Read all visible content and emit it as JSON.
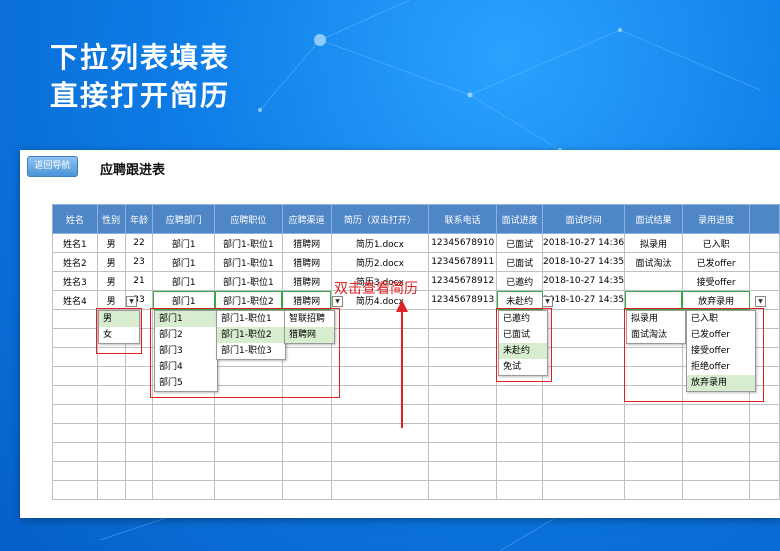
{
  "hero": {
    "line1": "下拉列表填表",
    "line2": "直接打开简历"
  },
  "sheet": {
    "nav_button": "返回导航",
    "title": "应聘跟进表"
  },
  "table": {
    "headers": [
      "姓名",
      "性别",
      "年龄",
      "应聘部门",
      "应聘职位",
      "应聘渠道",
      "简历（双击打开）",
      "联系电话",
      "面试进度",
      "面试时间",
      "面试结果",
      "录用进度"
    ],
    "rows": [
      [
        "姓名1",
        "男",
        "22",
        "部门1",
        "部门1-职位1",
        "猎聘网",
        "简历1.docx",
        "12345678910",
        "已面试",
        "2018-10-27 14:36",
        "拟录用",
        "已入职"
      ],
      [
        "姓名2",
        "男",
        "23",
        "部门1",
        "部门1-职位1",
        "猎聘网",
        "简历2.docx",
        "12345678911",
        "已面试",
        "2018-10-27 14:35",
        "面试淘汰",
        "已发offer"
      ],
      [
        "姓名3",
        "男",
        "21",
        "部门1",
        "部门1-职位1",
        "猎聘网",
        "简历3.docx",
        "12345678912",
        "已邀约",
        "2018-10-27 14:35",
        "",
        "接受offer"
      ],
      [
        "姓名4",
        "男",
        "33",
        "部门1",
        "部门1-职位2",
        "猎聘网",
        "简历4.docx",
        "12345678913",
        "未赴约",
        "2018-10-27 14:35",
        "",
        "放弃录用"
      ]
    ]
  },
  "dropdowns": {
    "gender": [
      "男",
      "女"
    ],
    "department": [
      "部门1",
      "部门2",
      "部门3",
      "部门4",
      "部门5"
    ],
    "position": [
      "部门1-职位1",
      "部门1-职位2",
      "部门1-职位3"
    ],
    "channel": [
      "智联招聘",
      "猎聘网"
    ],
    "progress": [
      "已邀约",
      "已面试",
      "未赴约",
      "免试"
    ],
    "result": [
      "拟录用",
      "面试淘汰"
    ],
    "hire": [
      "已入职",
      "已发offer",
      "接受offer",
      "拒绝offer",
      "放弃录用"
    ]
  },
  "callout": "双击查看简历",
  "colors": {
    "header": "#4f86c6",
    "highlight_box": "#e02020",
    "selected_option": "#d8ecd0",
    "selected_cell": "#3aa64a"
  }
}
